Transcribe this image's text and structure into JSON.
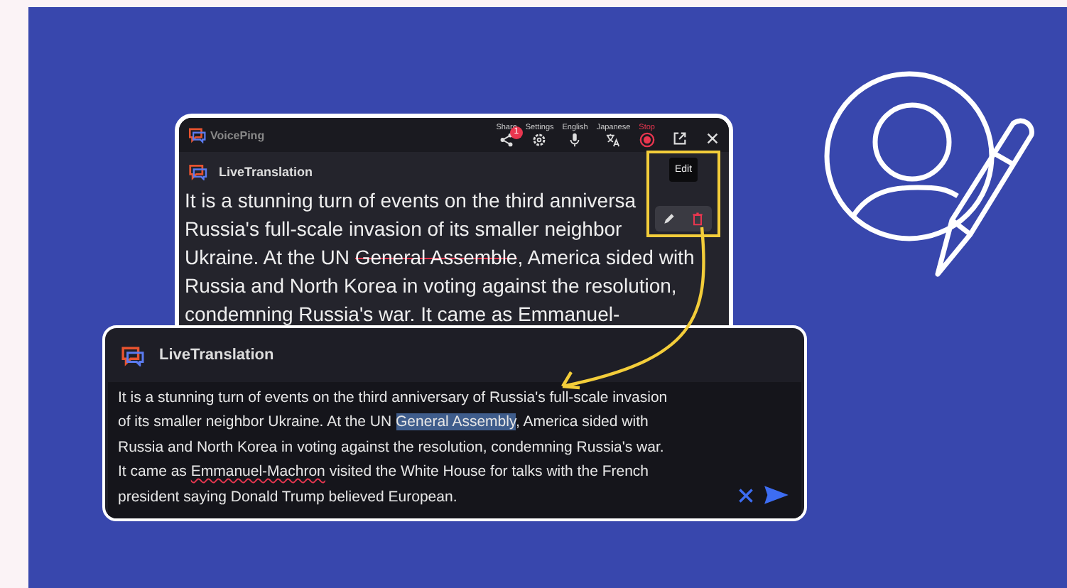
{
  "back_window": {
    "app_name": "VoicePing",
    "toolbar": [
      {
        "kind": "share",
        "label": "Share",
        "badge": "1"
      },
      {
        "kind": "settings",
        "label": "Settings"
      },
      {
        "kind": "mic",
        "label": "English"
      },
      {
        "kind": "translate",
        "label": "Japanese"
      },
      {
        "kind": "stop",
        "label": "Stop"
      }
    ],
    "message": {
      "sender": "LiveTranslation",
      "lines": [
        [
          {
            "kind": "plain",
            "text": "It is a stunning turn of events on the third anniversa"
          }
        ],
        [
          {
            "kind": "plain",
            "text": "Russia's full-scale invasion of its smaller neighbor"
          }
        ],
        [
          {
            "kind": "plain",
            "text": "Ukraine. At the UN "
          },
          {
            "kind": "struck",
            "text": "General Assemble"
          },
          {
            "kind": "plain",
            "text": ", America sided with"
          }
        ],
        [
          {
            "kind": "plain",
            "text": "Russia and North Korea in voting against the resolution,"
          }
        ],
        [
          {
            "kind": "plain",
            "text": "condemning Russia's war. It came as Emmanuel-"
          }
        ]
      ]
    },
    "edit_tooltip": "Edit"
  },
  "edit_panel": {
    "sender": "LiveTranslation",
    "lines": [
      [
        {
          "kind": "plain",
          "text": "It is a stunning turn of events on the third anniversary of Russia's full-scale invasion"
        }
      ],
      [
        {
          "kind": "plain",
          "text": "of its smaller neighbor Ukraine. At the UN "
        },
        {
          "kind": "selected",
          "text": "General Assembly"
        },
        {
          "kind": "plain",
          "text": ", America sided with"
        }
      ],
      [
        {
          "kind": "plain",
          "text": "Russia and North Korea in voting against the resolution, condemning Russia's war."
        }
      ],
      [
        {
          "kind": "plain",
          "text": "It came as "
        },
        {
          "kind": "misspelled",
          "text": "Emmanuel-Machron"
        },
        {
          "kind": "plain",
          "text": " visited the White House for talks with the French"
        }
      ],
      [
        {
          "kind": "plain",
          "text": "president saying Donald Trump believed European."
        }
      ]
    ]
  }
}
